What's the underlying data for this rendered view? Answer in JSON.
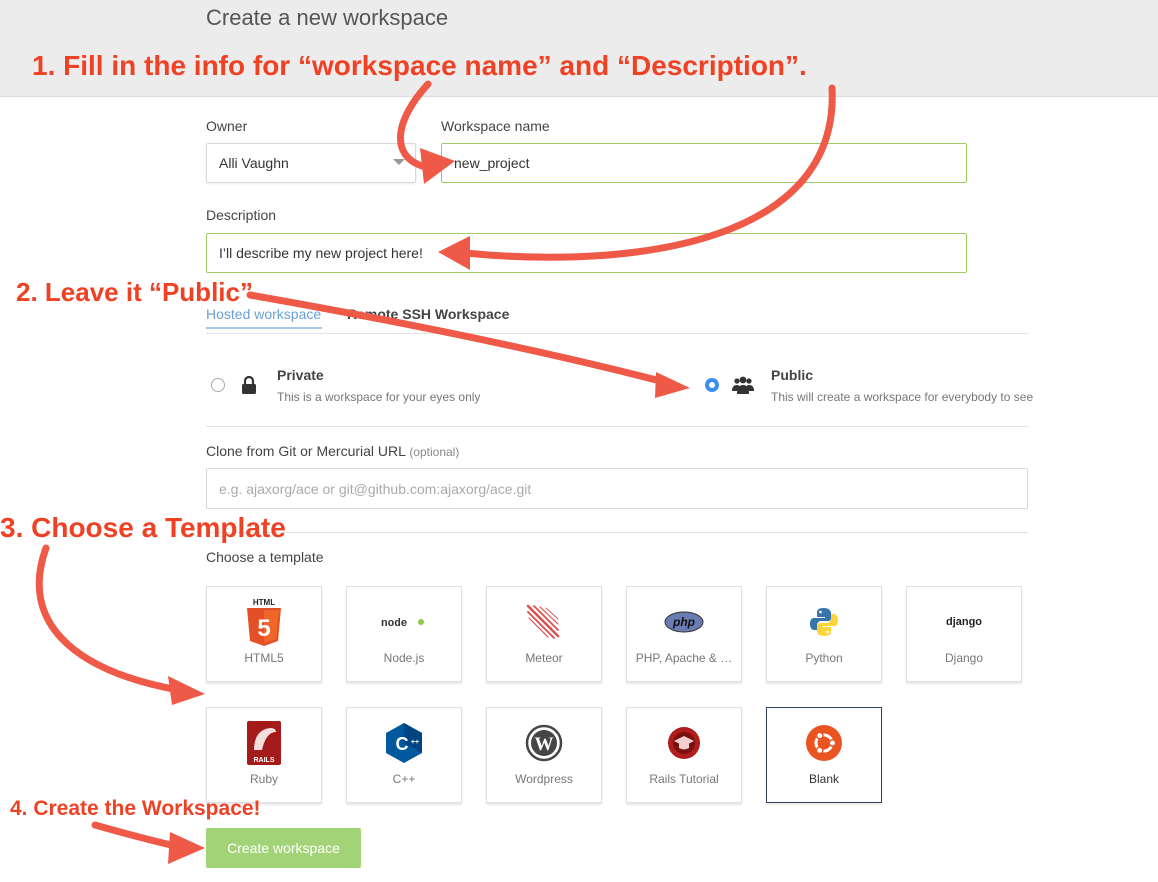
{
  "page": {
    "title": "Create a new workspace"
  },
  "form": {
    "owner": {
      "label": "Owner",
      "value": "Alli Vaughn"
    },
    "workspace_name": {
      "label": "Workspace name",
      "value": "new_project"
    },
    "description": {
      "label": "Description",
      "value": "I’ll describe my new project here!"
    }
  },
  "tabs": [
    {
      "label": "Hosted workspace",
      "active": true
    },
    {
      "label": "Remote SSH Workspace",
      "active": false
    }
  ],
  "visibility": {
    "selected": "public",
    "private": {
      "title": "Private",
      "description": "This is a workspace for your eyes only",
      "icon": "lock-icon"
    },
    "public": {
      "title": "Public",
      "description": "This will create a workspace for everybody to see",
      "icon": "users-icon"
    }
  },
  "clone": {
    "label": "Clone from Git or Mercurial URL",
    "optional": "(optional)",
    "placeholder": "e.g. ajaxorg/ace or git@github.com:ajaxorg/ace.git"
  },
  "templates": {
    "label": "Choose a template",
    "selected": "Blank",
    "items": [
      {
        "label": "HTML5",
        "icon": "html5-icon",
        "logo_text": "HTML"
      },
      {
        "label": "Node.js",
        "icon": "nodejs-icon",
        "logo_text": "node"
      },
      {
        "label": "Meteor",
        "icon": "meteor-icon"
      },
      {
        "label": "PHP, Apache & …",
        "icon": "php-icon",
        "logo_text": "php"
      },
      {
        "label": "Python",
        "icon": "python-icon"
      },
      {
        "label": "Django",
        "icon": "django-icon",
        "logo_text": "django"
      },
      {
        "label": "Ruby",
        "icon": "rails-icon",
        "logo_text": "RAILS"
      },
      {
        "label": "C++",
        "icon": "cpp-icon",
        "logo_text": "C"
      },
      {
        "label": "Wordpress",
        "icon": "wordpress-icon",
        "logo_text": "W"
      },
      {
        "label": "Rails Tutorial",
        "icon": "rails-tutorial-icon"
      },
      {
        "label": "Blank",
        "icon": "ubuntu-icon"
      }
    ]
  },
  "create_button": {
    "label": "Create workspace"
  },
  "annotations": {
    "step1": "1. Fill in the info for “workspace name” and “Description”.",
    "step2": "2. Leave it “Public”",
    "step3": "3. Choose a Template",
    "step4": "4. Create the Workspace!"
  },
  "colors": {
    "annotation": "#ef4124",
    "valid_border": "#9ccc65",
    "radio_selected": "#3b8ef0",
    "tab_active": "#6a9fd4",
    "button": "#a3d377"
  }
}
